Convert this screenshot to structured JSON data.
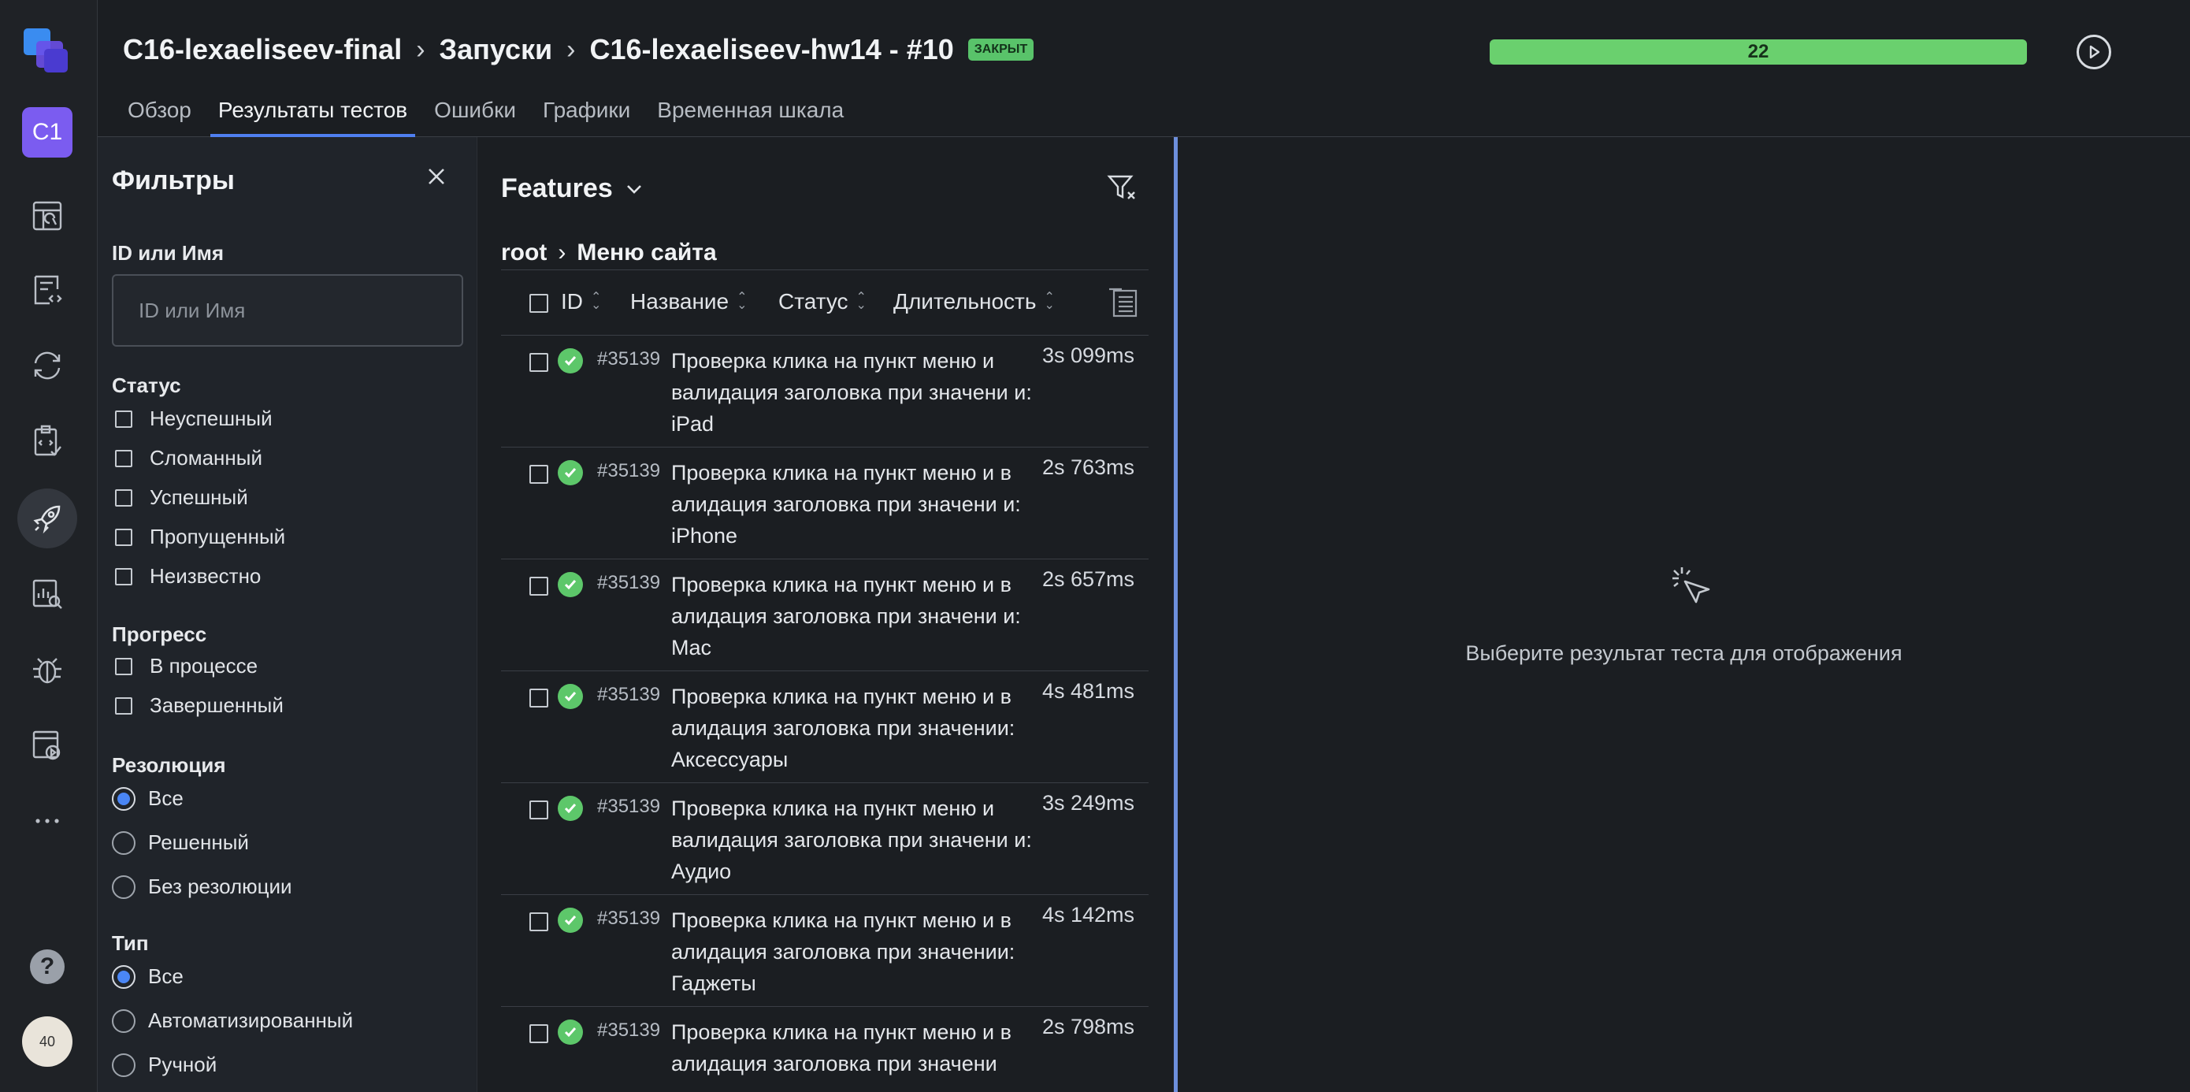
{
  "rail": {
    "project_initials": "C1",
    "avatar_text": "40"
  },
  "header": {
    "breadcrumb": [
      "C16-lexaeliseev-final",
      "Запуски",
      "C16-lexaeliseev-hw14 - #10"
    ],
    "badge": "ЗАКРЫТ",
    "progress_value": "22",
    "tabs": [
      "Обзор",
      "Результаты тестов",
      "Ошибки",
      "Графики",
      "Временная шкала"
    ],
    "active_tab": "Результаты тестов"
  },
  "filters": {
    "title": "Фильтры",
    "id_label": "ID или Имя",
    "id_placeholder": "ID или Имя",
    "status_label": "Статус",
    "status_options": [
      "Неуспешный",
      "Сломанный",
      "Успешный",
      "Пропущенный",
      "Неизвестно"
    ],
    "progress_label": "Прогресс",
    "progress_options": [
      "В процессе",
      "Завершенный"
    ],
    "resolution_label": "Резолюция",
    "resolution_options": [
      "Все",
      "Решенный",
      "Без резолюции"
    ],
    "resolution_selected": "Все",
    "type_label": "Тип",
    "type_options": [
      "Все",
      "Автоматизированный",
      "Ручной"
    ],
    "type_selected": "Все"
  },
  "tree": {
    "title": "Features",
    "path": [
      "root",
      "Меню сайта"
    ],
    "columns": [
      "ID",
      "Название",
      "Статус",
      "Длительность"
    ],
    "rows": [
      {
        "id": "#35139",
        "name": "Проверка клика на пункт меню и валидация заголовка при значени и: iPad",
        "duration": "3s 099ms",
        "status": "passed"
      },
      {
        "id": "#35139",
        "name": "Проверка клика на пункт меню и в алидация заголовка при значени и: iPhone",
        "duration": "2s 763ms",
        "status": "passed"
      },
      {
        "id": "#35139",
        "name": "Проверка клика на пункт меню и в алидация заголовка при значени и: Mac",
        "duration": "2s 657ms",
        "status": "passed"
      },
      {
        "id": "#35139",
        "name": "Проверка клика на пункт меню и в алидация заголовка при значении: Аксессуары",
        "duration": "4s 481ms",
        "status": "passed"
      },
      {
        "id": "#35139",
        "name": "Проверка клика на пункт меню и валидация заголовка при значени и: Аудио",
        "duration": "3s 249ms",
        "status": "passed"
      },
      {
        "id": "#35139",
        "name": "Проверка клика на пункт меню и в алидация заголовка при значении: Гаджеты",
        "duration": "4s 142ms",
        "status": "passed"
      },
      {
        "id": "#35139",
        "name": "Проверка клика на пункт меню и в алидация заголовка при значени",
        "duration": "2s 798ms",
        "status": "passed"
      }
    ]
  },
  "detail": {
    "empty_message": "Выберите результат теста для отображения"
  },
  "colors": {
    "accent": "#4f7ff0",
    "success": "#5dc76a",
    "progress": "#6ad06e",
    "project": "#7b5cf0"
  }
}
